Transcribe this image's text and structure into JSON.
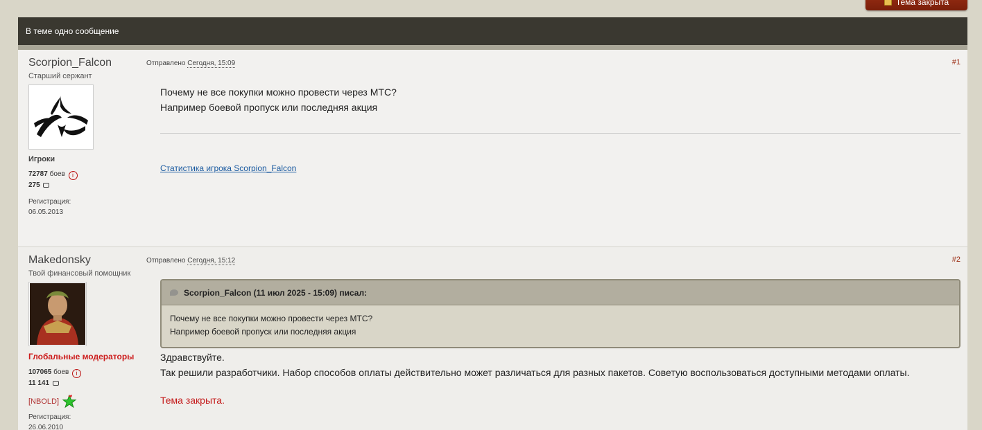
{
  "header": {
    "closed_button_label": "Тема закрыта",
    "topic_count_label": "В теме одно сообщение"
  },
  "posts": [
    {
      "author": "Scorpion_Falcon",
      "rank": "Старший сержант",
      "group": "Игроки",
      "battles": "72787",
      "battles_label": "боев",
      "posts_count": "275",
      "reg_label": "Регистрация:",
      "reg_date": "06.05.2013",
      "posted_label": "Отправлено",
      "posted_date": "Сегодня, 15:09",
      "number": "#1",
      "lines": [
        "Почему не все покупки можно провести через МТС?",
        "Например боевой пропуск или последняя акция"
      ],
      "signature_link": "Статистика игрока Scorpion_Falcon"
    },
    {
      "author": "Makedonsky",
      "rank": "Твой финансовый помощник",
      "group": "Глобальные модераторы",
      "battles": "107065",
      "battles_label": "боев",
      "posts_count": "11 141",
      "clan": "[NBOLD]",
      "reg_label": "Регистрация:",
      "reg_date": "26.06.2010",
      "posted_label": "Отправлено",
      "posted_date": "Сегодня, 15:12",
      "number": "#2",
      "quote": {
        "header": "Scorpion_Falcon (11 июл 2025 - 15:09) писал:",
        "lines": [
          "Почему не все покупки можно провести через МТС?",
          "Например боевой пропуск или последняя акция"
        ]
      },
      "lines": [
        "Здравствуйте.",
        "Так решили разработчики. Набор способов оплаты действительно может различаться для разных пакетов. Советую воспользоваться доступными методами оплаты."
      ],
      "closed_text": "Тема закрыта."
    }
  ]
}
